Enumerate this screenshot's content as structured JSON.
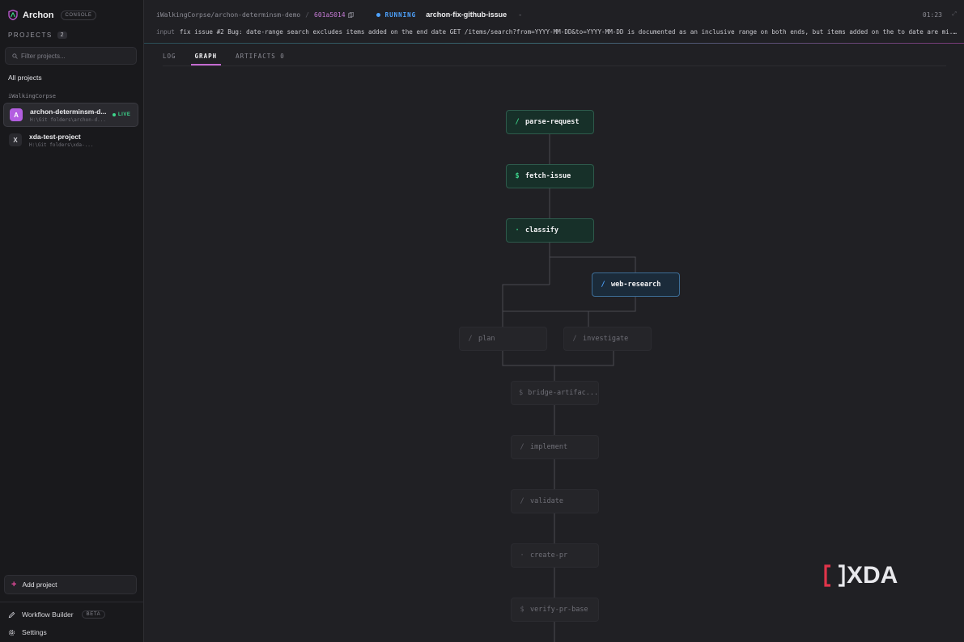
{
  "sidebar": {
    "brand": "Archon",
    "brand_badge": "CONSOLE",
    "projects_label": "PROJECTS",
    "projects_count": "2",
    "filter_placeholder": "Filter projects...",
    "all_projects": "All projects",
    "group_label": "iWalkingCorpse",
    "projects": [
      {
        "initial": "A",
        "name": "archon-determinsm-d...",
        "path": "H:\\Git folders\\archon-d...",
        "badge": "LIVE",
        "avatar_color": "#b35ee0"
      },
      {
        "initial": "X",
        "name": "xda-test-project",
        "path": "H:\\Git folders\\xda-...",
        "avatar_color": "#2a2a2f"
      }
    ],
    "add_project": "Add project",
    "workflow_builder": "Workflow Builder",
    "beta": "BETA",
    "settings": "Settings"
  },
  "header": {
    "repo": "iWalkingCorpse/archon-determinsm-demo",
    "sha": "601a5014",
    "status": "RUNNING",
    "workflow": "archon-fix-github-issue",
    "dash": "-",
    "timer": "01:23",
    "input_key": "input",
    "input_value": "fix issue #2 Bug: date-range search excludes items added on the end date GET /items/search?from=YYYY-MM-DD&to=YYYY-MM-DD is documented as an inclusive range on both ends, but items added on the to date are mi..."
  },
  "tabs": [
    {
      "label": "LOG",
      "active": false
    },
    {
      "label": "GRAPH",
      "active": true
    },
    {
      "label": "ARTIFACTS 0",
      "active": false
    }
  ],
  "graph": {
    "nodes": [
      {
        "id": "parse-request",
        "icon": "/",
        "label": "parse-request",
        "state": "done"
      },
      {
        "id": "fetch-issue",
        "icon": "$",
        "label": "fetch-issue",
        "state": "done"
      },
      {
        "id": "classify",
        "icon": "·",
        "label": "classify",
        "state": "done"
      },
      {
        "id": "web-research",
        "icon": "/",
        "label": "web-research",
        "state": "running"
      },
      {
        "id": "plan",
        "icon": "/",
        "label": "plan",
        "state": "pending"
      },
      {
        "id": "investigate",
        "icon": "/",
        "label": "investigate",
        "state": "pending"
      },
      {
        "id": "bridge-artifacts",
        "icon": "$",
        "label": "bridge-artifac...",
        "state": "pending"
      },
      {
        "id": "implement",
        "icon": "/",
        "label": "implement",
        "state": "pending"
      },
      {
        "id": "validate",
        "icon": "/",
        "label": "validate",
        "state": "pending"
      },
      {
        "id": "create-pr",
        "icon": "·",
        "label": "create-pr",
        "state": "pending"
      },
      {
        "id": "verify-pr-base",
        "icon": "$",
        "label": "verify-pr-base",
        "state": "pending"
      }
    ]
  },
  "watermark": "XDA",
  "colors": {
    "accent": "#c46ad0",
    "running": "#4ea3ff",
    "done": "#3dd68c",
    "watermark_bracket": "#e0344a"
  }
}
